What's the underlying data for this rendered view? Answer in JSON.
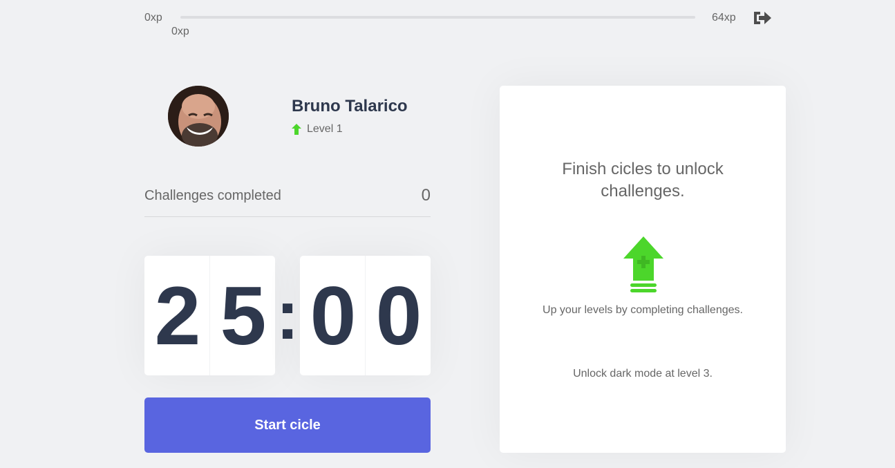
{
  "experience": {
    "min_label": "0xp",
    "current_label": "0xp",
    "max_label": "64xp",
    "progress_fraction": 0,
    "logout_icon": "logout-icon"
  },
  "profile": {
    "name": "Bruno Talarico",
    "level_label": "Level 1",
    "level_icon": "level-up-arrow-icon",
    "avatar": "avatar"
  },
  "challenges": {
    "label": "Challenges completed",
    "count": "0"
  },
  "timer": {
    "minute_left": "2",
    "minute_right": "5",
    "separator": ":",
    "second_left": "0",
    "second_right": "0"
  },
  "actions": {
    "start_label": "Start cicle"
  },
  "challenge_card": {
    "title": "Finish cicles to unlock challenges.",
    "description": "Up your levels by completing challenges.",
    "dark_mode_note": "Unlock dark mode at level 3.",
    "icon": "level-up-icon"
  },
  "colors": {
    "background": "#f0f1f3",
    "title": "#2e384d",
    "text": "#666666",
    "blue": "#5965e0",
    "green": "#4cd62b"
  }
}
